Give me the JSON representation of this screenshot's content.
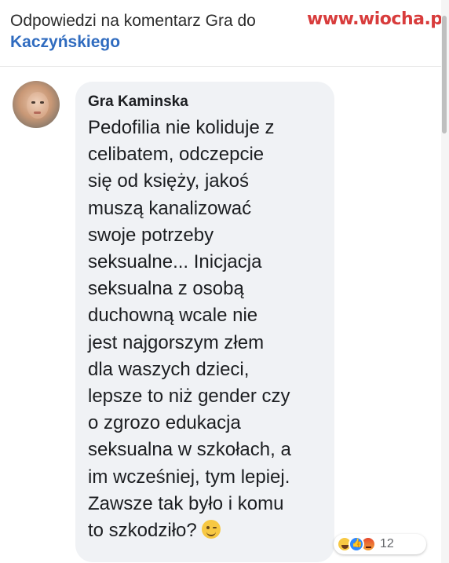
{
  "header": {
    "title_prefix": "Odpowiedzi na komentarz Gra do",
    "title_name": "Kaczyńskiego"
  },
  "watermark": "www.wiocha.pl",
  "comment": {
    "author": "Gra Kaminska",
    "text": "Pedofilia nie koliduje z\ncelibatem, odczepcie\nsię od księży, jakoś\nmuszą kanalizować\nswoje potrzeby\nseksualne...  Inicjacja\nseksualna z osobą\nduchowną wcale nie\njest najgorszym złem\ndla waszych dzieci,\nlepsze to niż gender czy\no zgrozo edukacja\nseksualna w szkołach, a\nim wcześniej, tym lepiej.\nZawsze tak było i komu\nto szkodziło?",
    "emoji": "wink-emoji",
    "reactions": {
      "icons": [
        "haha-reaction-icon",
        "like-reaction-icon",
        "angry-reaction-icon"
      ],
      "count": "12"
    }
  },
  "colors": {
    "link": "#2f6bbf",
    "bubble": "#f0f2f5",
    "watermark": "#d83c3c"
  }
}
